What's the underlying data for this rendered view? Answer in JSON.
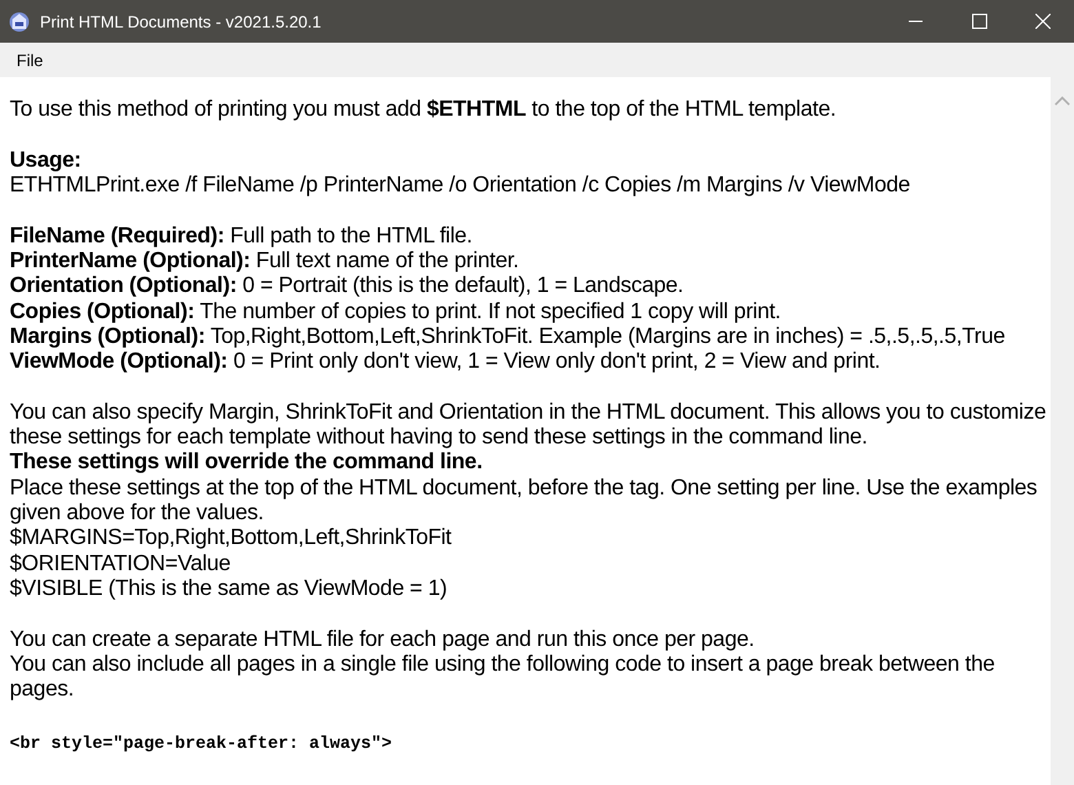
{
  "window": {
    "title": "Print HTML Documents - v2021.5.20.1"
  },
  "menu": [
    "File"
  ],
  "sections": [
    [
      {
        "kind": "text",
        "text": "To use this method of printing you must add **$ETHTML** to the top of the HTML template."
      }
    ],
    [
      {
        "kind": "text",
        "text": "Usage:",
        "bold": true
      },
      {
        "kind": "text",
        "text": "ETHTMLPrint.exe /f FileName /p PrinterName /o Orientation /c Copies /m Margins /v ViewMode"
      }
    ],
    [
      {
        "kind": "text",
        "text": "**FileName (Required):** Full path to the HTML file."
      },
      {
        "kind": "text",
        "text": "**PrinterName (Optional):** Full text name of the printer."
      },
      {
        "kind": "text",
        "text": "**Orientation (Optional):** 0 = Portrait (this is the default), 1 = Landscape."
      },
      {
        "kind": "text",
        "text": "**Copies (Optional):** The number of copies to print. If not specified 1 copy will print."
      },
      {
        "kind": "text",
        "text": "**Margins (Optional):** Top,Right,Bottom,Left,ShrinkToFit. Example (Margins are in inches) = .5,.5,.5,.5,True"
      },
      {
        "kind": "text",
        "text": "**ViewMode (Optional):** 0 = Print only don't view, 1 = View only don't print, 2 = View and print."
      }
    ],
    [
      {
        "kind": "text",
        "text": "You can also specify Margin, ShrinkToFit and Orientation in the HTML document. This allows you to customize these settings for each template without having to send these settings in the command line."
      },
      {
        "kind": "text",
        "text": "These settings will override the command line.",
        "bold": true
      },
      {
        "kind": "text",
        "text": "Place these settings at the top of the HTML document, before the tag. One setting per line. Use the examples given above for the values."
      },
      {
        "kind": "text",
        "text": "$MARGINS=Top,Right,Bottom,Left,ShrinkToFit"
      },
      {
        "kind": "text",
        "text": "$ORIENTATION=Value"
      },
      {
        "kind": "text",
        "text": "$VISIBLE (This is the same as ViewMode = 1)"
      }
    ],
    [
      {
        "kind": "text",
        "text": "You can create a separate HTML file for each page and run this once per page."
      },
      {
        "kind": "text",
        "text": "You can also include all pages in a single file using the following code to insert a page break between the pages."
      }
    ],
    [
      {
        "kind": "code",
        "text": "<br style=\"page-break-after: always\">"
      }
    ]
  ]
}
